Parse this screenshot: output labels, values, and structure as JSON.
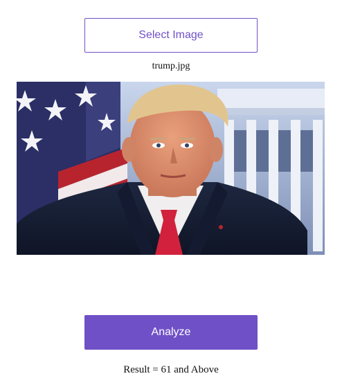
{
  "upload": {
    "select_label": "Select Image",
    "filename": "trump.jpg"
  },
  "preview": {
    "alt": "trump.jpg",
    "scene": [
      "american-flag",
      "white-house",
      "portrait-in-suit-red-tie"
    ]
  },
  "actions": {
    "analyze_label": "Analyze"
  },
  "result": {
    "text": "Result = 61 and Above"
  },
  "colors": {
    "accent": "#7050c6",
    "text": "#111111",
    "background": "#ffffff"
  }
}
